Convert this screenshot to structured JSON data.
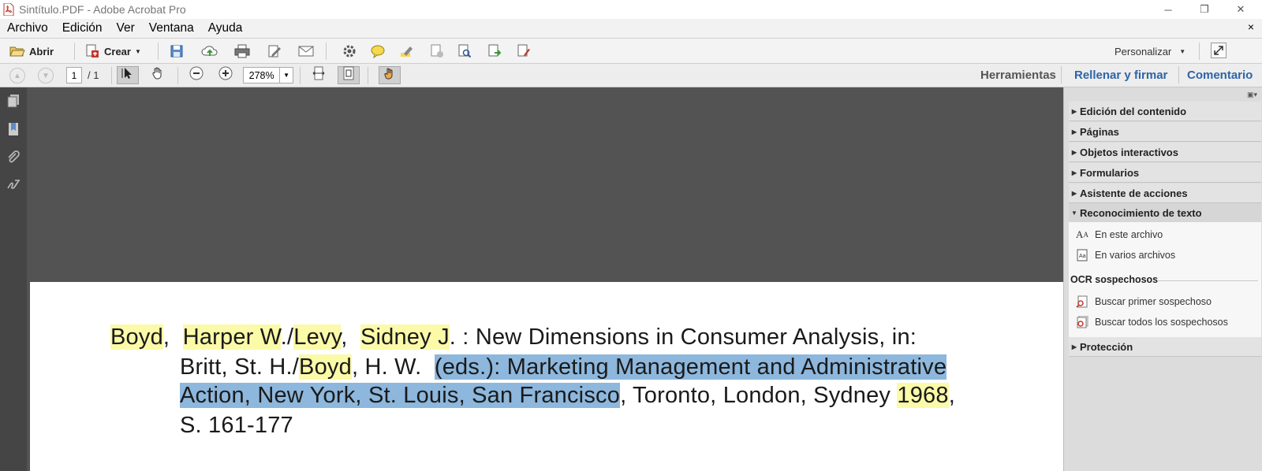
{
  "window": {
    "title": "Sintítulo.PDF - Adobe Acrobat Pro",
    "minimize_glyph": "─",
    "restore_glyph": "❐",
    "close_glyph": "✕"
  },
  "menubar": {
    "items": [
      "Archivo",
      "Edición",
      "Ver",
      "Ventana",
      "Ayuda"
    ],
    "close_doc_glyph": "×"
  },
  "toolbar": {
    "open_label": "Abrir",
    "create_label": "Crear",
    "customize_label": "Personalizar",
    "icons": [
      "save-icon",
      "upload-cloud-icon",
      "print-icon",
      "edit-icon",
      "email-icon",
      "gear-icon",
      "comment-icon",
      "highlight-icon",
      "protect-icon",
      "search-icon",
      "export-icon",
      "sign-icon"
    ]
  },
  "navbar": {
    "page_current": "1",
    "page_total": "/ 1",
    "zoom": "278%",
    "tabs": {
      "tools": "Herramientas",
      "fill_sign": "Rellenar y firmar",
      "comment": "Comentario"
    }
  },
  "document": {
    "lines": [
      [
        {
          "t": "Boyd",
          "h": "y"
        },
        {
          "t": ",  "
        },
        {
          "t": "Harper W",
          "h": "y"
        },
        {
          "t": "./"
        },
        {
          "t": "Levy",
          "h": "y"
        },
        {
          "t": ",  "
        },
        {
          "t": "Sidney J",
          "h": "y"
        },
        {
          "t": ". : New Dimensions in Consumer Analysis, in:"
        }
      ],
      [
        {
          "t": "Britt, St. H./"
        },
        {
          "t": "Boyd",
          "h": "y"
        },
        {
          "t": ", H. W.  "
        },
        {
          "t": "(eds.): Marketing Management and Administrative",
          "h": "b"
        }
      ],
      [
        {
          "t": "Action, New York, St. Louis, San Francisco",
          "h": "b"
        },
        {
          "t": ", Toronto, London, Sydney "
        },
        {
          "t": "1968",
          "h": "y"
        },
        {
          "t": ","
        }
      ],
      [
        {
          "t": "S. 161-177"
        }
      ]
    ]
  },
  "right_panel": {
    "sections": [
      {
        "label": "Edición del contenido",
        "expanded": false
      },
      {
        "label": "Páginas",
        "expanded": false
      },
      {
        "label": "Objetos interactivos",
        "expanded": false
      },
      {
        "label": "Formularios",
        "expanded": false
      },
      {
        "label": "Asistente de acciones",
        "expanded": false
      },
      {
        "label": "Reconocimiento de texto",
        "expanded": true
      }
    ],
    "ocr_items": [
      "En este archivo",
      "En varios archivos"
    ],
    "suspects_heading": "OCR sospechosos",
    "suspect_items": [
      "Buscar primer sospechoso",
      "Buscar todos los sospechosos"
    ],
    "protection_label": "Protección"
  },
  "colors": {
    "highlight_yellow": "#fbfaa8",
    "selection_blue": "#8db7dc",
    "tab_blue": "#2d64a8",
    "doc_background": "#535353"
  }
}
